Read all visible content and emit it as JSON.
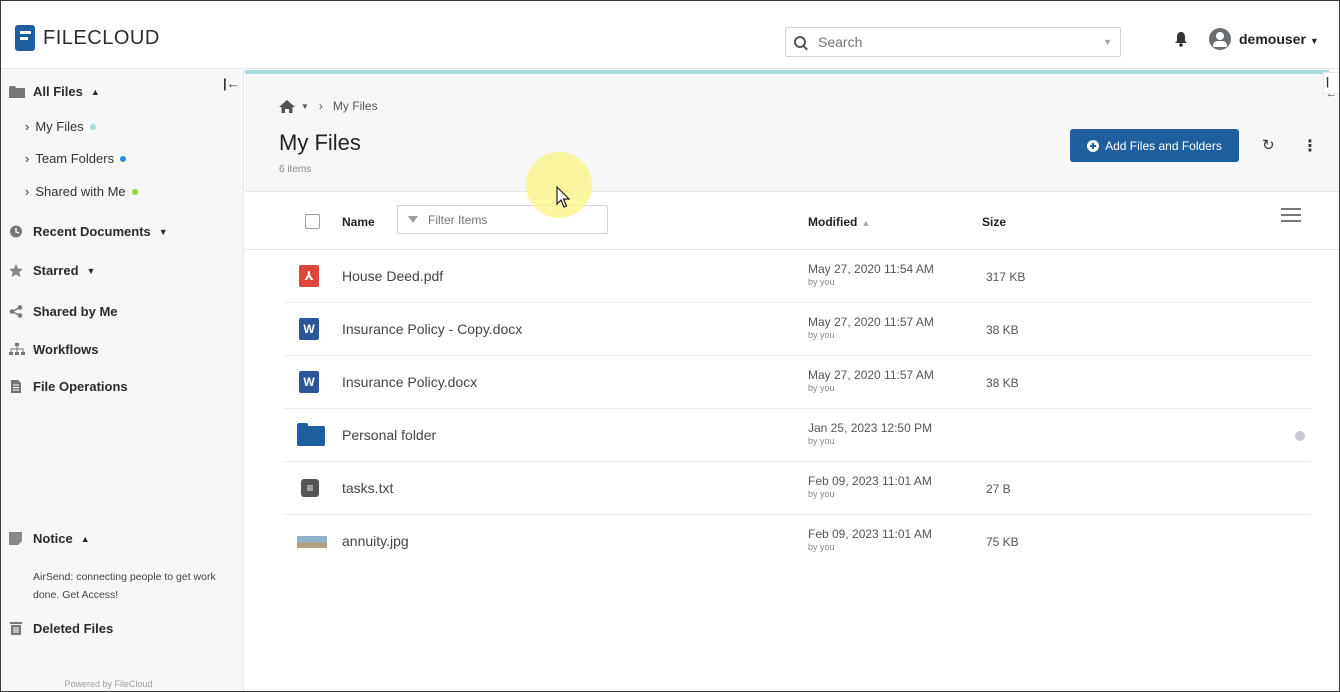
{
  "header": {
    "logo_text_bold": "FILE",
    "logo_text_rest": "CLOUD",
    "search_placeholder": "Search",
    "username": "demouser"
  },
  "sidebar": {
    "all_files": "All Files",
    "sub_items": [
      {
        "label": "My Files",
        "dot_color": "#a8dadb"
      },
      {
        "label": "Team Folders",
        "dot_color": "#2d8ae0"
      },
      {
        "label": "Shared with Me",
        "dot_color": "#9bd43a"
      }
    ],
    "recent_documents": "Recent Documents",
    "starred": "Starred",
    "shared_by_me": "Shared by Me",
    "workflows": "Workflows",
    "file_operations": "File Operations",
    "notice": "Notice",
    "notice_text": "AirSend: connecting people to get work done. Get Access!",
    "deleted_files": "Deleted Files",
    "powered_by": "Powered by FileCloud"
  },
  "main": {
    "breadcrumb_current": "My Files",
    "title": "My Files",
    "item_count": "6 items",
    "add_button": "Add Files and Folders",
    "columns": {
      "name": "Name",
      "filter_placeholder": "Filter Items",
      "modified": "Modified",
      "size": "Size"
    },
    "files": [
      {
        "name": "House Deed.pdf",
        "modified": "May 27, 2020 11:54 AM",
        "by": "by you",
        "size": "317 KB",
        "type": "pdf"
      },
      {
        "name": "Insurance Policy - Copy.docx",
        "modified": "May 27, 2020 11:57 AM",
        "by": "by you",
        "size": "38 KB",
        "type": "word"
      },
      {
        "name": "Insurance Policy.docx",
        "modified": "May 27, 2020 11:57 AM",
        "by": "by you",
        "size": "38 KB",
        "type": "word"
      },
      {
        "name": "Personal folder",
        "modified": "Jan 25, 2023 12:50 PM",
        "by": "by you",
        "size": "",
        "type": "folder"
      },
      {
        "name": "tasks.txt",
        "modified": "Feb 09, 2023 11:01 AM",
        "by": "by you",
        "size": "27 B",
        "type": "txt"
      },
      {
        "name": "annuity.jpg",
        "modified": "Feb 09, 2023 11:01 AM",
        "by": "by you",
        "size": "75 KB",
        "type": "image"
      }
    ]
  },
  "colors": {
    "brand_blue": "#1f5fa0",
    "accent_teal": "#a8dadb",
    "pdf_red": "#e0453a",
    "word_blue": "#2b579a"
  }
}
